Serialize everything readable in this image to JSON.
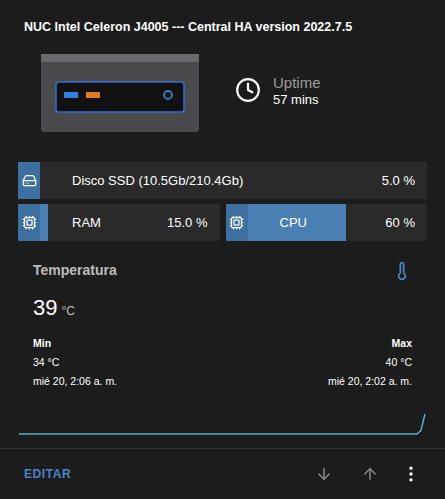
{
  "card": {
    "title": "NUC Intel Celeron J4005 --- Central HA version 2022.7.5",
    "uptime": {
      "label": "Uptime",
      "value": "57 mins"
    }
  },
  "bars": [
    {
      "kind": "disk",
      "label": "Disco SSD (10.5Gb/210.4Gb)",
      "value": "5.0 %",
      "level": 0.05
    },
    {
      "kind": "chip",
      "label": "RAM",
      "value": "15.0 %",
      "level": 0.15
    },
    {
      "kind": "chip",
      "label": "CPU",
      "value": "60 %",
      "level": 0.6
    }
  ],
  "temperature": {
    "title": "Temperatura",
    "value": "39",
    "unit": "°C",
    "min": {
      "label": "Min",
      "value": "34 °C",
      "time": "mié 20, 2:06 a. m."
    },
    "max": {
      "label": "Max",
      "value": "40 °C",
      "time": "mié 20, 2:02 a. m."
    },
    "series": [
      34,
      34,
      34,
      34,
      34,
      34,
      34,
      34,
      34,
      34,
      34,
      34,
      34,
      34,
      34,
      34,
      34,
      34,
      34,
      34,
      34,
      34,
      34,
      34,
      34,
      34,
      34,
      34,
      34,
      34,
      34,
      34,
      34,
      34,
      34,
      34,
      34,
      34,
      34,
      34,
      34,
      34,
      34,
      34,
      34,
      34,
      34,
      34,
      34,
      34,
      34,
      34,
      34,
      34,
      34,
      34,
      34,
      34,
      34,
      34,
      34,
      34,
      34,
      34,
      34,
      34,
      34,
      34,
      34,
      34,
      34,
      34,
      34,
      34,
      34,
      34,
      34,
      34,
      34,
      34,
      34,
      34,
      34,
      34,
      34,
      34,
      34,
      34,
      34,
      34,
      34,
      34,
      34,
      34,
      34,
      34,
      34,
      34,
      35,
      40
    ]
  },
  "footer": {
    "edit": "EDITAR"
  }
}
